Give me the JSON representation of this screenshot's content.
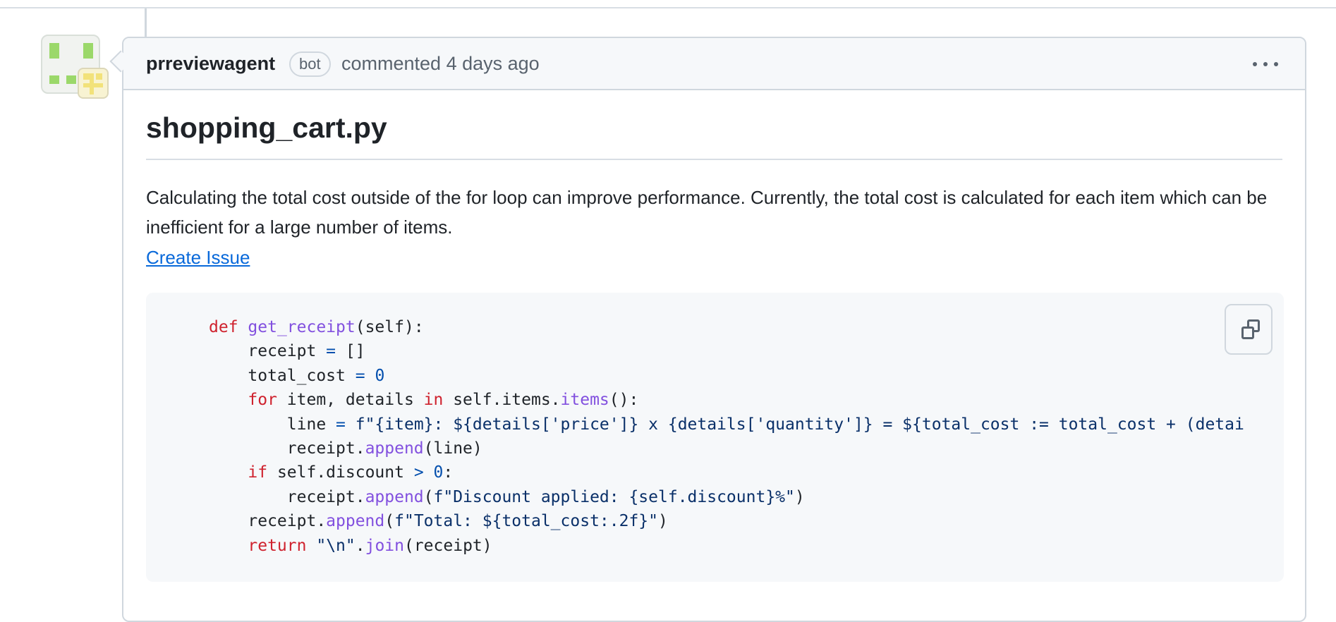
{
  "comment": {
    "author": "prreviewagent",
    "badge": "bot",
    "meta": "commented 4 days ago"
  },
  "body": {
    "title": "shopping_cart.py",
    "description": "Calculating the total cost outside of the for loop can improve performance. Currently, the total cost is calculated for each item which can be inefficient for a large number of items.",
    "link": "Create Issue"
  },
  "code": {
    "language": "python",
    "lines": [
      "def get_receipt(self):",
      "    receipt = []",
      "    total_cost = 0",
      "    for item, details in self.items.items():",
      "        line = f\"{item}: ${details['price']} x {details['quantity']} = ${total_cost := total_cost + (detai",
      "        receipt.append(line)",
      "    if self.discount > 0:",
      "        receipt.append(f\"Discount applied: {self.discount}%\")",
      "    receipt.append(f\"Total: ${total_cost:.2f}\")",
      "    return \"\\n\".join(receipt)"
    ]
  },
  "icons": {
    "menu": "kebab-horizontal-icon",
    "copy": "copy-icon"
  },
  "colors": {
    "link": "#0969da",
    "keyword": "#cf222e",
    "function": "#8250df",
    "operator": "#0550ae",
    "string": "#0a3069"
  }
}
